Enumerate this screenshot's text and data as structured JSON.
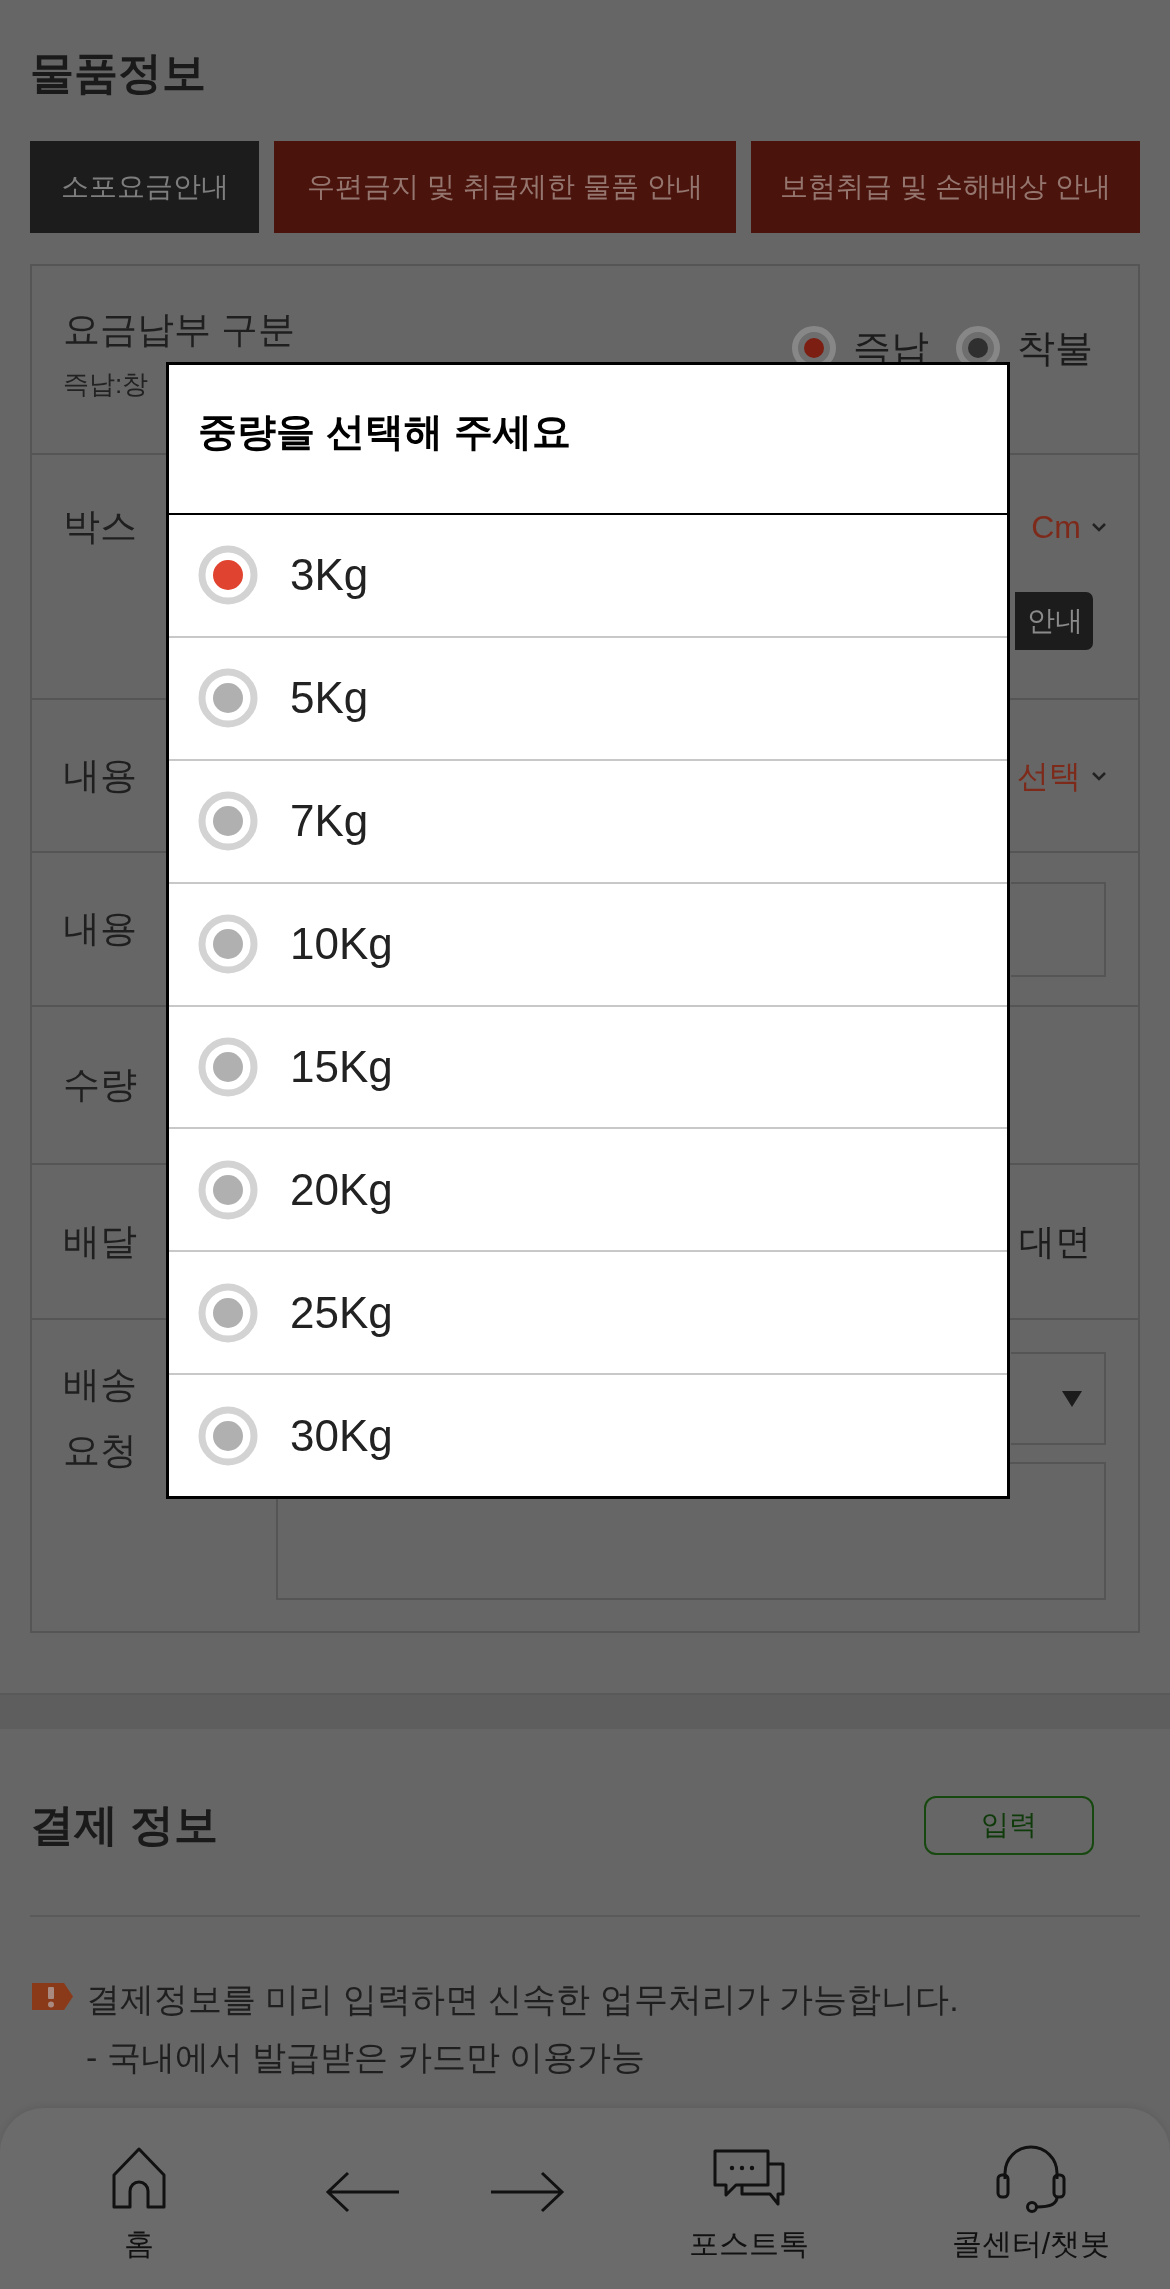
{
  "title": "물품정보",
  "guide_buttons": [
    {
      "label": "소포요금안내",
      "kind": "dark"
    },
    {
      "label": "우편금지 및 취급제한 물품 안내",
      "kind": "accent"
    },
    {
      "label": "보험취급 및 손해배상 안내",
      "kind": "accent"
    }
  ],
  "form_rows": [
    {
      "kind": "radio",
      "label": "요금납부 구분",
      "note": "즉납:창",
      "options": [
        {
          "label": "즉납",
          "selected": true
        },
        {
          "label": "착불",
          "selected": false
        }
      ]
    },
    {
      "kind": "dropdown",
      "label": "박스",
      "value": "Cm",
      "badge": "안내"
    },
    {
      "kind": "dropdown",
      "label": "내용",
      "value": "선택"
    },
    {
      "kind": "input",
      "label": "내용"
    },
    {
      "kind": "plain",
      "label": "수량"
    },
    {
      "kind": "text",
      "label": "배달",
      "value": "대면"
    },
    {
      "kind": "request",
      "label_lines": [
        "배송",
        "요청"
      ]
    }
  ],
  "weight_dialog": {
    "title": "중량을 선택해 주세요",
    "options": [
      {
        "label": "3Kg",
        "selected": true
      },
      {
        "label": "5Kg",
        "selected": false
      },
      {
        "label": "7Kg",
        "selected": false
      },
      {
        "label": "10Kg",
        "selected": false
      },
      {
        "label": "15Kg",
        "selected": false
      },
      {
        "label": "20Kg",
        "selected": false
      },
      {
        "label": "25Kg",
        "selected": false
      },
      {
        "label": "30Kg",
        "selected": false
      }
    ]
  },
  "payment": {
    "title": "결제 정보",
    "button": "입력",
    "notice": [
      "결제정보를 미리 입력하면 신속한 업무처리가 가능합니다.",
      "- 국내에서 발급받은 카드만 이용가능"
    ]
  },
  "bottom_nav": [
    {
      "kind": "home",
      "label": "홈"
    },
    {
      "kind": "back"
    },
    {
      "kind": "forward"
    },
    {
      "kind": "chat",
      "label": "포스트톡"
    },
    {
      "kind": "headset",
      "label": "콜센터/챗봇"
    }
  ]
}
